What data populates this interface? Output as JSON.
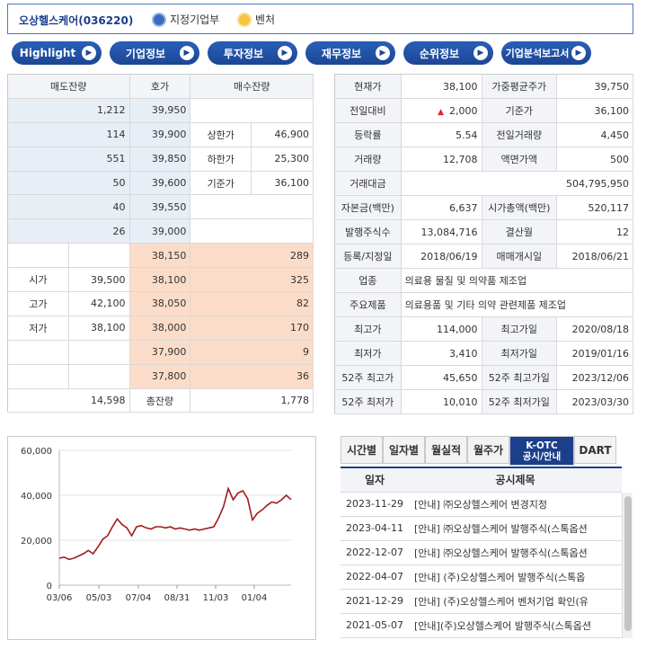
{
  "header": {
    "company": "오상헬스케어(036220)",
    "badge1": "지정기업부",
    "badge2": "벤처"
  },
  "nav": [
    "Highlight",
    "기업정보",
    "투자정보",
    "재무정보",
    "순위정보",
    "기업분석보고서"
  ],
  "order_book": {
    "headers": [
      "매도잔량",
      "호가",
      "매수잔량"
    ],
    "sell_rows": [
      {
        "qty": "1,212",
        "price": "39,950"
      },
      {
        "qty": "114",
        "price": "39,900"
      },
      {
        "qty": "551",
        "price": "39,850"
      },
      {
        "qty": "50",
        "price": "39,600"
      },
      {
        "qty": "40",
        "price": "39,550"
      },
      {
        "qty": "26",
        "price": "39,000"
      }
    ],
    "side_labels": [
      {
        "label": "상한가",
        "value": "46,900"
      },
      {
        "label": "하한가",
        "value": "25,300"
      },
      {
        "label": "기준가",
        "value": "36,100"
      }
    ],
    "buy_rows": [
      {
        "label": "",
        "value": "",
        "price": "38,150",
        "qty": "289"
      },
      {
        "label": "시가",
        "value": "39,500",
        "price": "38,100",
        "qty": "325"
      },
      {
        "label": "고가",
        "value": "42,100",
        "price": "38,050",
        "qty": "82"
      },
      {
        "label": "저가",
        "value": "38,100",
        "price": "38,000",
        "qty": "170"
      },
      {
        "label": "",
        "value": "",
        "price": "37,900",
        "qty": "9"
      },
      {
        "label": "",
        "value": "",
        "price": "37,800",
        "qty": "36"
      }
    ],
    "total_sell": "14,598",
    "total_label": "총잔량",
    "total_buy": "1,778"
  },
  "info": {
    "rows": [
      [
        "현재가",
        "38,100",
        "가중평균주가",
        "39,750"
      ],
      [
        "전일대비",
        "2,000",
        "기준가",
        "36,100"
      ],
      [
        "등락률",
        "5.54",
        "전일거래량",
        "4,450"
      ],
      [
        "거래량",
        "12,708",
        "액면가액",
        "500"
      ],
      [
        "거래대금",
        "504,795,950"
      ],
      [
        "자본금(백만)",
        "6,637",
        "시가총액(백만)",
        "520,117"
      ],
      [
        "발행주식수",
        "13,084,716",
        "결산월",
        "12"
      ],
      [
        "등록/지정일",
        "2018/06/19",
        "매매개시일",
        "2018/06/21"
      ],
      [
        "업종",
        "의료용 물질 및 의약품 제조업"
      ],
      [
        "주요제품",
        "의료용품 및 기타 의약 관련제품 제조업"
      ],
      [
        "최고가",
        "114,000",
        "최고가일",
        "2020/08/18"
      ],
      [
        "최저가",
        "3,410",
        "최저가일",
        "2019/01/16"
      ],
      [
        "52주 최고가",
        "45,650",
        "52주 최고가일",
        "2023/12/06"
      ],
      [
        "52주 최저가",
        "10,010",
        "52주 최저가일",
        "2023/03/30"
      ]
    ],
    "up_color": "#e0232a"
  },
  "chart_data": {
    "type": "line",
    "x": [
      "03/06",
      "05/03",
      "07/04",
      "08/31",
      "11/03",
      "01/04"
    ],
    "y_ticks": [
      "60,000",
      "40,000",
      "20,000",
      "0"
    ],
    "ylim": [
      0,
      60000
    ],
    "series": [
      {
        "values": [
          12000,
          12500,
          11500,
          12000,
          13000,
          14000,
          15500,
          14000,
          17000,
          20500,
          22000,
          26000,
          29500,
          27000,
          25500,
          22000,
          26000,
          26500,
          25500,
          25000,
          26000,
          26000,
          25500,
          26000,
          25000,
          25500,
          25000,
          24500,
          25000,
          24500,
          25000,
          25500,
          26000,
          30000,
          35000,
          43000,
          38000,
          41000,
          42000,
          38500,
          29000,
          32000,
          33500,
          35500,
          37000,
          36500,
          38000,
          40000,
          38100
        ]
      }
    ],
    "color": "#a01c1c"
  },
  "tabs": [
    "시간별",
    "일자별",
    "월실적",
    "월주가",
    "K-OTC",
    "공시/안내",
    "DART"
  ],
  "notices": {
    "headers": [
      "일자",
      "공시제목"
    ],
    "rows": [
      [
        "2023-11-29",
        "[안내] ㈜오상헬스케어 변경지정"
      ],
      [
        "2023-04-11",
        "[안내] ㈜오상헬스케어 발행주식(스톡옵션"
      ],
      [
        "2022-12-07",
        "[안내] ㈜오상헬스케어 발행주식(스톡옵션"
      ],
      [
        "2022-04-07",
        "[안내] (주)오상헬스케어 발행주식(스톡옵"
      ],
      [
        "2021-12-29",
        "[안내] (주)오상헬스케어 벤처기업 확인(유"
      ],
      [
        "2021-05-07",
        "[안내](주)오상헬스케어 발행주식(스톡옵션"
      ]
    ]
  }
}
